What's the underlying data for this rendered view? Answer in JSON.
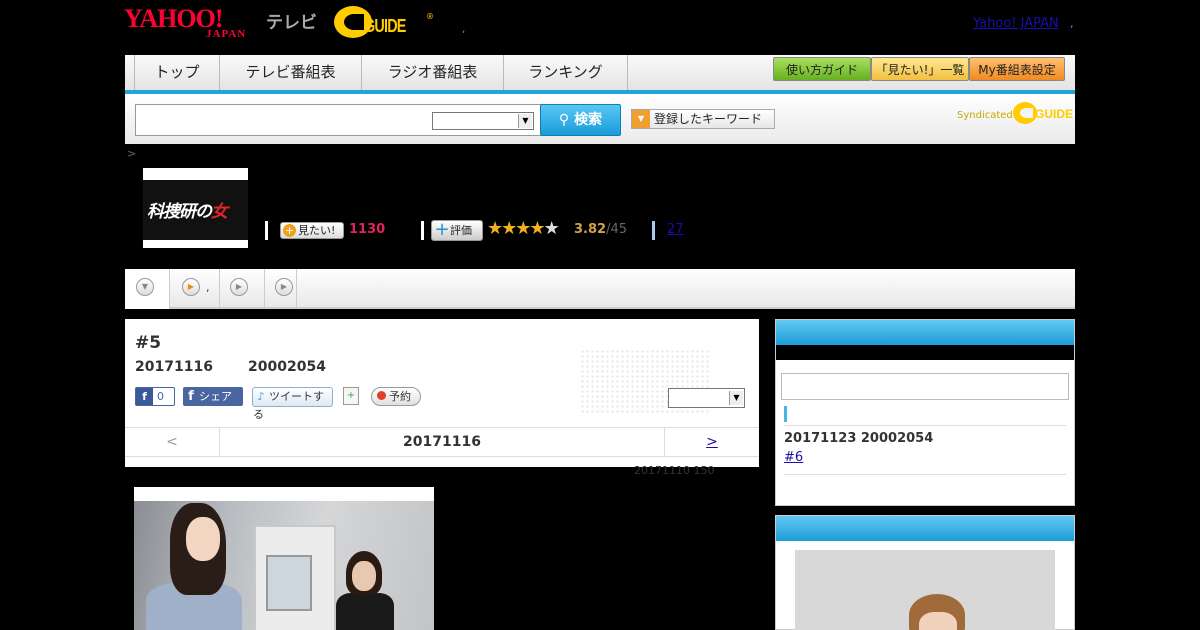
{
  "header": {
    "yahoo_logo": "YAHOO!",
    "yahoo_sub": "JAPAN",
    "tv_label": "テレビ",
    "gguide_logo": "GUIDE",
    "gguide_reg": "®",
    "header_dot": ",",
    "yahoo_japan_link": "Yahoo! JAPAN",
    "header_comma": ","
  },
  "nav": {
    "tabs": [
      "トップ",
      "テレビ番組表",
      "ラジオ番組表",
      "ランキング"
    ],
    "guide_button": "使い方ガイド",
    "mitai_list_button": "「見たい!」一覧",
    "my_schedule_button": "My番組表設定"
  },
  "search": {
    "button_label": "検索",
    "keyword_button": "登録したキーワード",
    "syndicated": "Syndicated",
    "syn_logo": "GUIDE"
  },
  "breadcrumb": ">",
  "program": {
    "thumb_title_a": "科捜研の",
    "thumb_title_b": "女",
    "mitai_label": "見たい!",
    "mitai_count": "1130",
    "hyouka_label": "評価",
    "rating_stars_filled": 4,
    "rating_stars_total": 5,
    "score": "3.82",
    "score_den": "/45",
    "review_count": "27"
  },
  "tabs": {
    "active_icon": "▼",
    "tab2_label": ",",
    "tab3_label": "",
    "tab4_label": ""
  },
  "episode": {
    "title": "#5",
    "date": "20171116",
    "time": "20002054",
    "like_count": "0",
    "share_label": "シェア",
    "tweet_label": "ツイートする",
    "reserve_label": "予約",
    "nav_prev": "<",
    "nav_date": "20171116",
    "nav_next": ">",
    "update_note": "20171110  150"
  },
  "sidebar": {
    "next_date": "20171123  20002054",
    "next_link": "#6"
  },
  "colors": {
    "accent_blue": "#22a3dd",
    "mitai_pink": "#e0245e",
    "star_gold": "#f2b01e"
  }
}
